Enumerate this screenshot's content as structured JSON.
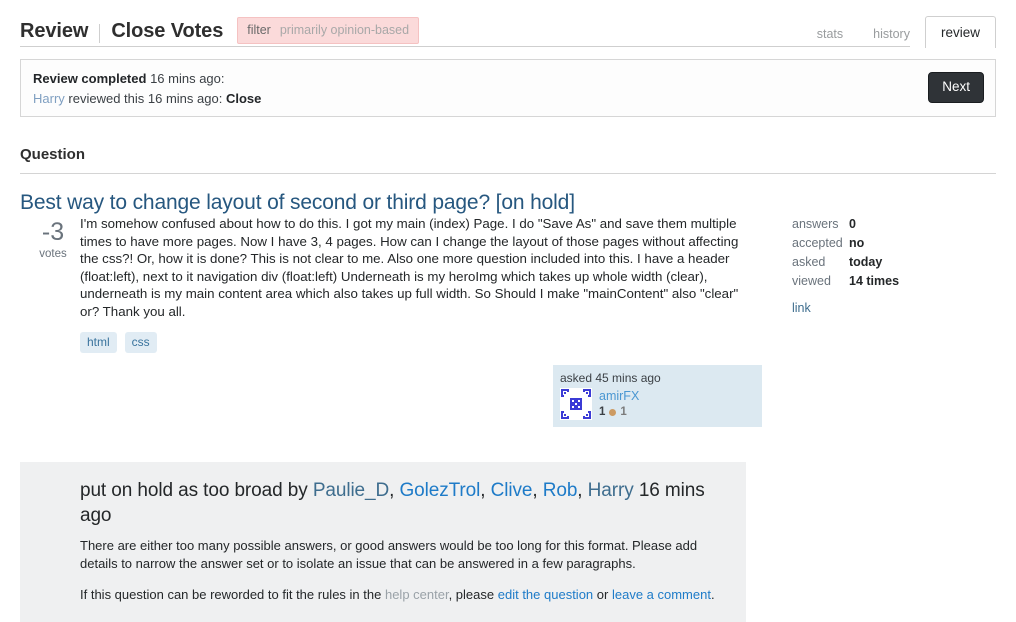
{
  "header": {
    "title": "Review",
    "separator": "|",
    "subtitle": "Close Votes",
    "filter_label": "filter",
    "filter_value": "primarily opinion-based",
    "tabs": [
      {
        "label": "stats",
        "active": false
      },
      {
        "label": "history",
        "active": false
      },
      {
        "label": "review",
        "active": true
      }
    ]
  },
  "review_banner": {
    "completed_label": "Review completed",
    "completed_time": "16 mins ago:",
    "reviewer": "Harry",
    "reviewed_text": "reviewed this 16 mins ago:",
    "action": "Close",
    "next_button": "Next"
  },
  "section": {
    "title": "Question"
  },
  "question": {
    "title": "Best way to change layout of second or third page? [on hold]",
    "votes": "-3",
    "votes_label": "votes",
    "body": "I'm somehow confused about how to do this. I got my main (index) Page. I do \"Save As\" and save them multiple times to have more pages. Now I have 3, 4 pages. How can I change the layout of those pages without affecting the css?! Or, how it is done? This is not clear to me. Also one more question included into this. I have a header (float:left), next to it navigation div (float:left) Underneath is my heroImg which takes up whole width (clear), underneath is my main content area which also takes up full width. So Should I make \"mainContent\" also \"clear\" or? Thank you all.",
    "tags": [
      "html",
      "css"
    ]
  },
  "stats": {
    "rows": [
      {
        "key": "answers",
        "value": "0"
      },
      {
        "key": "accepted",
        "value": "no"
      },
      {
        "key": "asked",
        "value": "today"
      },
      {
        "key": "viewed",
        "value": "14 times"
      }
    ],
    "link": "link"
  },
  "user_card": {
    "action": "asked 45 mins ago",
    "username": "amirFX",
    "reputation": "1",
    "badge_count": "1",
    "avatar_icon": "identicon-avatar"
  },
  "closed_notice": {
    "prefix": "put on hold as",
    "reason": "too broad",
    "by": "by",
    "users": [
      "Paulie_D",
      "GolezTrol",
      "Clive",
      "Rob",
      "Harry"
    ],
    "time": "16 mins ago",
    "paragraph1": "There are either too many possible answers, or good answers would be too long for this format. Please add details to narrow the answer set or to isolate an issue that can be answered in a few paragraphs.",
    "p2_before": "If this question can be reworded to fit the rules in the",
    "help_center": "help center",
    "p2_mid": ", please",
    "edit_link": "edit the question",
    "p2_or": "or",
    "comment_link": "leave a comment",
    "p2_end": "."
  },
  "colors": {
    "accent_link": "#1e7bc8",
    "title_link": "#26577f",
    "tag_bg": "#e1ecf4",
    "tag_fg": "#39739d",
    "filter_bg": "#fbdada",
    "user_card_bg": "#dce9f1",
    "notice_bg": "#eff0f1",
    "next_btn_bg": "#2f3337",
    "badge_bronze": "#cc9a62"
  }
}
